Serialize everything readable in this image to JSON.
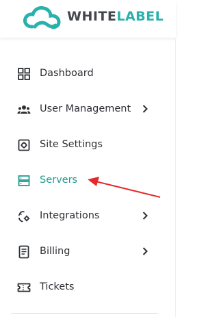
{
  "brand": {
    "part1": "WHITE",
    "part2": "LABEL"
  },
  "colors": {
    "accent": "#1f9a8f",
    "brand_teal": "#29b1ac",
    "text": "#2e3035",
    "annotation": "#e32b2b"
  },
  "sidebar": {
    "items": [
      {
        "label": "Dashboard",
        "icon": "dashboard-icon"
      },
      {
        "label": "User Management",
        "icon": "users-icon",
        "expandable": true
      },
      {
        "label": "Site Settings",
        "icon": "settings-icon"
      },
      {
        "label": "Servers",
        "icon": "server-icon",
        "active": true
      },
      {
        "label": "Integrations",
        "icon": "integrations-icon",
        "expandable": true
      },
      {
        "label": "Billing",
        "icon": "billing-icon",
        "expandable": true
      },
      {
        "label": "Tickets",
        "icon": "ticket-icon"
      }
    ]
  }
}
